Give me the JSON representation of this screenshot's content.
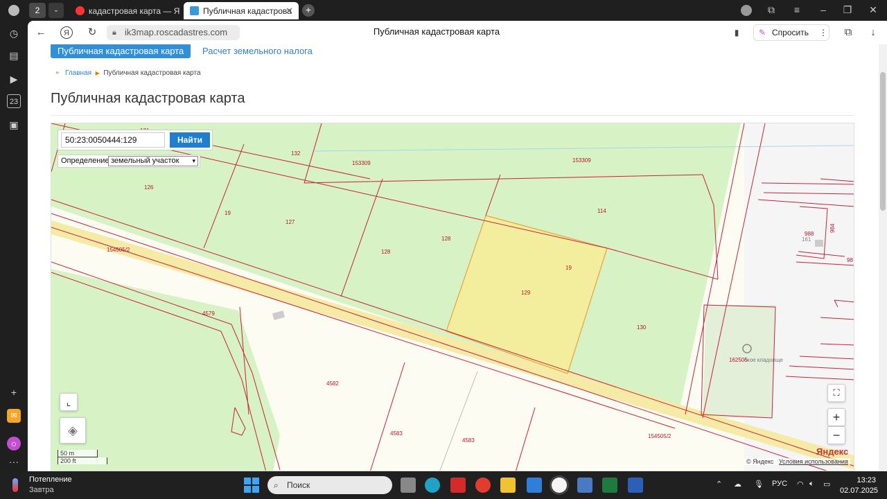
{
  "browser": {
    "tab_count": "2",
    "tabs": [
      {
        "title": "кадастровая карта — Янд"
      },
      {
        "title": "Публичная кадастрова"
      }
    ],
    "url": "ik3map.roscadastres.com",
    "page_title": "Публичная кадастровая карта",
    "ask_label": "Спросить"
  },
  "site": {
    "nav_tabs": [
      "Публичная кадастровая карта",
      "Расчет земельного налога"
    ],
    "breadcrumb_home": "Главная",
    "breadcrumb_current": "Публичная кадастровая карта",
    "heading": "Публичная кадастровая карта"
  },
  "map": {
    "search_value": "50:23:0050444:129",
    "find_button": "Найти",
    "definition_label": "Определение:",
    "definition_value": "земельный участок",
    "parcel_labels": [
      "121",
      "132",
      "153309",
      "153309",
      "126",
      "19",
      "127",
      "128",
      "128",
      "114",
      "154505/2",
      "19",
      "129",
      "4579",
      "130",
      "4582",
      "4583",
      "4583",
      "154505/2",
      "988",
      "984",
      "161",
      "98",
      "162505",
      "ское кладоище"
    ],
    "scale_top": "50 m",
    "scale_bottom": "200 ft",
    "copyright": "© Яндекс",
    "terms": "Условия использования",
    "logo": "Яндекс",
    "zoom_in": "+",
    "zoom_out": "−",
    "colors": {
      "parcel_border": "#c8213a",
      "green": "#d7f2c5",
      "selected": "#f3ee9d",
      "road": "#f5eaa6"
    }
  },
  "taskbar": {
    "weather_title": "Потепление",
    "weather_sub": "Завтра",
    "search_placeholder": "Поиск",
    "language": "РУС",
    "time": "13:23",
    "date": "02.07.2025"
  }
}
